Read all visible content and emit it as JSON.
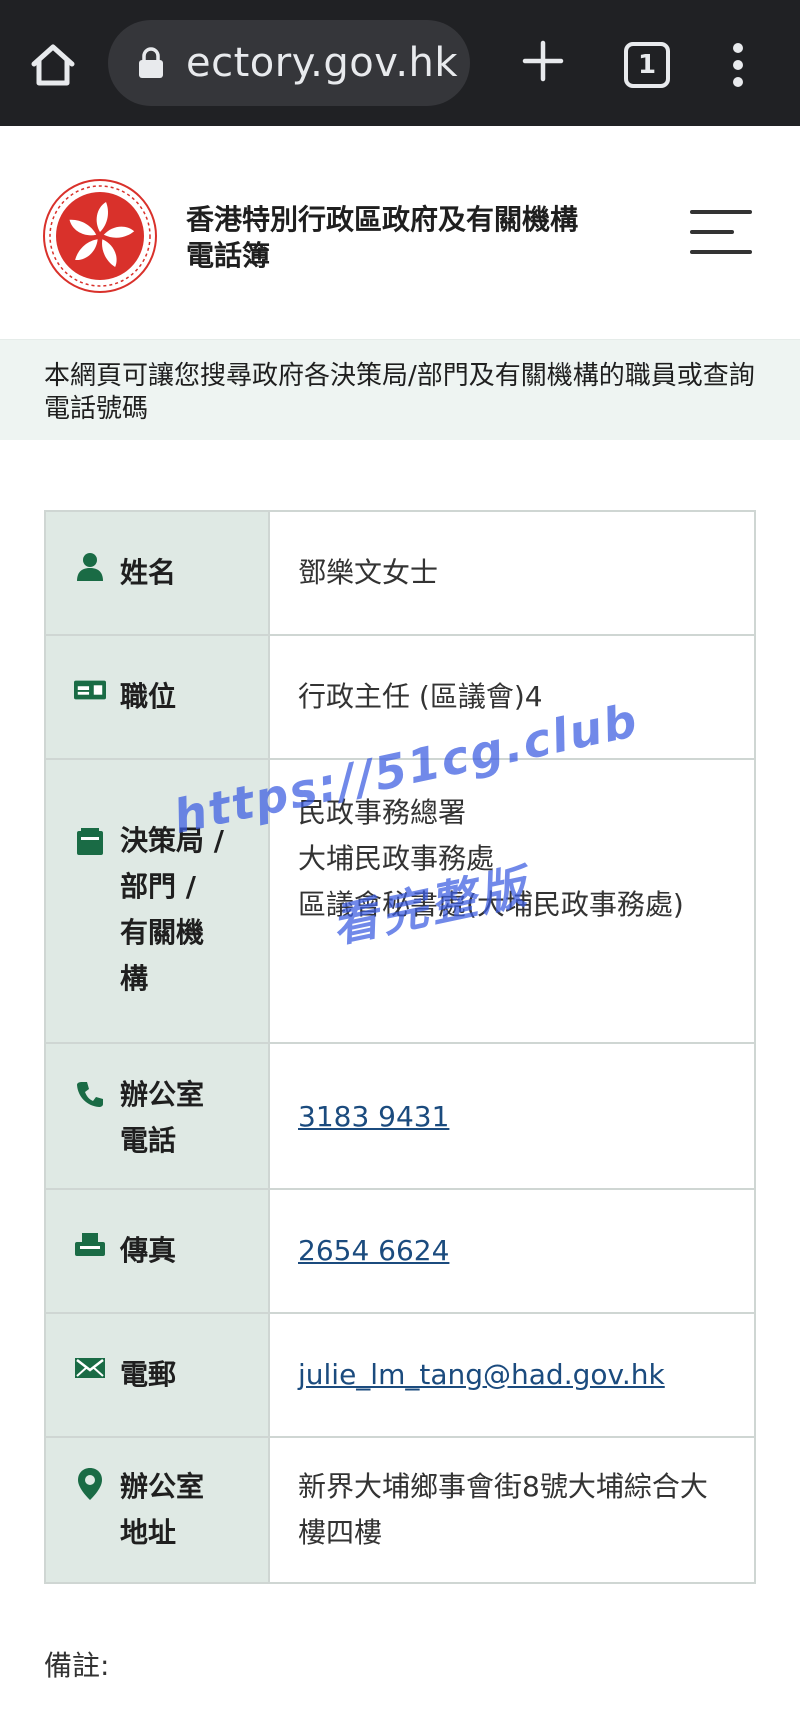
{
  "browser": {
    "url": "ectory.gov.hk",
    "tab_count": "1"
  },
  "site": {
    "title": "香港特別行政區政府及有關機構電話簿",
    "intro": "本網頁可讓您搜尋政府各決策局/部門及有關機構的職員或查詢電話號碼"
  },
  "details": {
    "name_label": "姓名",
    "name_value": "鄧樂文女士",
    "post_label": "職位",
    "post_value": "行政主任 (區議會)4",
    "dept_label": "決策局 / 部門 / 有關機構",
    "dept_line1": "民政事務總署",
    "dept_line2": "大埔民政事務處",
    "dept_line3": "區議會秘書處(大埔民政事務處)",
    "tel_label": "辦公室電話",
    "tel_value": "3183 9431",
    "fax_label": "傳真",
    "fax_value": "2654 6624",
    "email_label": "電郵",
    "email_value": "julie_lm_tang@had.gov.hk",
    "addr_label": "辦公室地址",
    "addr_value": "新界大埔鄉事會街8號大埔綜合大樓四樓"
  },
  "remarks_label": "備註:",
  "watermark": {
    "line1": "https://51cg.club",
    "line2": "看完整版"
  },
  "colors": {
    "icon_green": "#1a6b45",
    "label_bg": "#dfe9e4",
    "link": "#1b4b7e",
    "emblem_red": "#d9312b"
  }
}
